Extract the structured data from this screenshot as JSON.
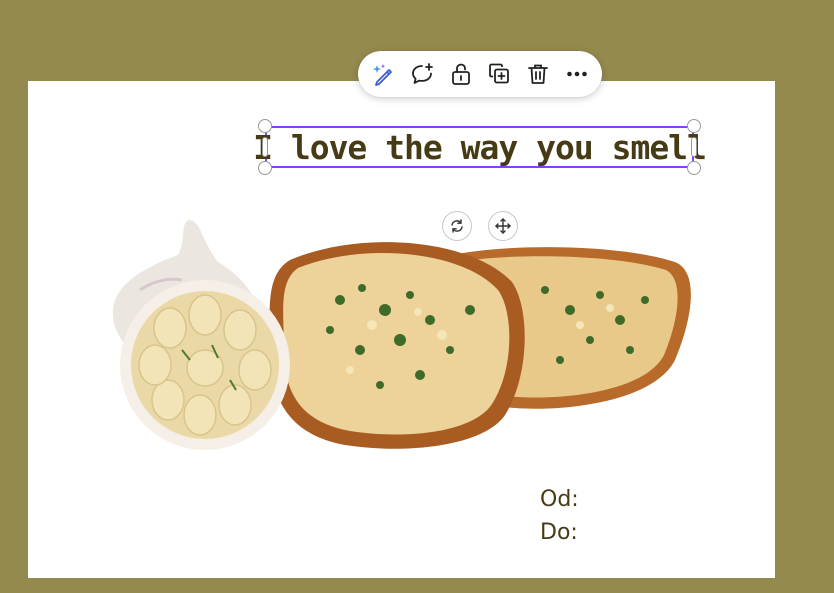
{
  "toolbar": {
    "items": [
      {
        "name": "magic-edit-icon"
      },
      {
        "name": "add-comment-icon"
      },
      {
        "name": "unlock-icon"
      },
      {
        "name": "duplicate-icon"
      },
      {
        "name": "delete-icon"
      },
      {
        "name": "more-options-icon"
      }
    ]
  },
  "design": {
    "headline": "I love the way you smell",
    "od_label": "Od:",
    "do_label": "Do:",
    "image": {
      "name": "garlic-bread-photo"
    }
  },
  "colors": {
    "canvas_background": "#948a4e",
    "page_background": "#ffffff",
    "selection": "#8b3dff",
    "headline_text": "#463b14"
  }
}
